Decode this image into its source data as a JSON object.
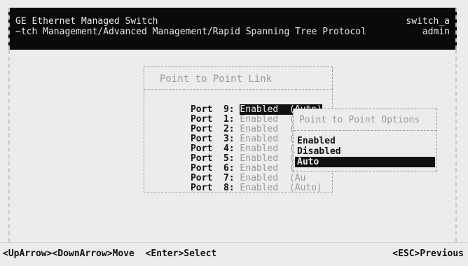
{
  "header": {
    "title": "GE Ethernet Managed Switch",
    "breadcrumb": "~tch Management/Advanced Management/Rapid Spanning Tree Protocol",
    "host": "switch_a",
    "user": "admin"
  },
  "dialog": {
    "title": "Point to Point Link",
    "ports": [
      {
        "label": "Port",
        "num": "9:",
        "value": "Enabled  (Auto)"
      },
      {
        "label": "Port",
        "num": "1:",
        "value": "Enabled  (Au"
      },
      {
        "label": "Port",
        "num": "2:",
        "value": "Enabled  (Au"
      },
      {
        "label": "Port",
        "num": "3:",
        "value": "Enabled  (Au"
      },
      {
        "label": "Port",
        "num": "4:",
        "value": "Enabled  (Au"
      },
      {
        "label": "Port",
        "num": "5:",
        "value": "Enabled  (Au"
      },
      {
        "label": "Port",
        "num": "6:",
        "value": "Enabled  (Au"
      },
      {
        "label": "Port",
        "num": "7:",
        "value": "Enabled  (Au"
      },
      {
        "label": "Port",
        "num": "8:",
        "value": "Enabled  (Auto)"
      }
    ]
  },
  "options_popup": {
    "title": "Point to Point Options",
    "options": [
      "Enabled",
      "Disabled",
      "Auto"
    ],
    "selected": "Auto"
  },
  "footer": {
    "hint_left": "<UpArrow><DownArrow>Move  <Enter>Select",
    "hint_right": "<ESC>Previous"
  }
}
